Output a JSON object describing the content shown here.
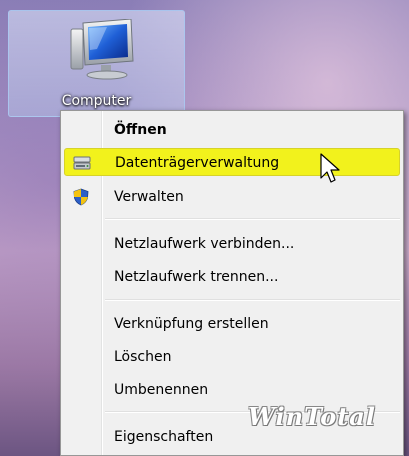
{
  "desktop": {
    "icon_label": "Computer"
  },
  "context_menu": {
    "items": [
      {
        "label": "Öffnen",
        "bold": true
      },
      {
        "label": "Datenträgerverwaltung",
        "highlighted": true,
        "icon": "disk-management-icon"
      },
      {
        "label": "Verwalten",
        "icon": "uac-shield-icon"
      },
      {
        "label": "Netzlaufwerk verbinden..."
      },
      {
        "label": "Netzlaufwerk trennen..."
      },
      {
        "label": "Verknüpfung erstellen"
      },
      {
        "label": "Löschen"
      },
      {
        "label": "Umbenennen"
      },
      {
        "label": "Eigenschaften"
      }
    ]
  },
  "watermark": "WinTotal",
  "colors": {
    "highlight": "#f2f21c",
    "menu_background": "#f0f0f0"
  }
}
